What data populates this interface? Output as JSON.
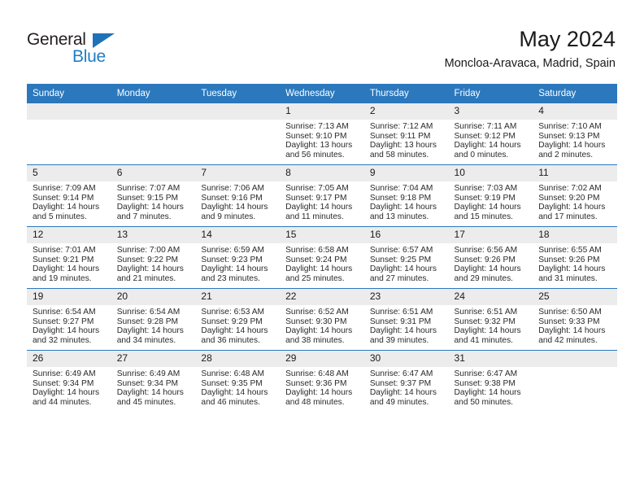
{
  "brand": {
    "logo_primary": "General",
    "logo_secondary": "Blue",
    "triangle_color": "#1f72b8",
    "accent_color": "#2b78bd"
  },
  "header": {
    "title": "May 2024",
    "subtitle": "Moncloa-Aravaca, Madrid, Spain"
  },
  "weekday_headers": [
    "Sunday",
    "Monday",
    "Tuesday",
    "Wednesday",
    "Thursday",
    "Friday",
    "Saturday"
  ],
  "labels": {
    "sunrise": "Sunrise:",
    "sunset": "Sunset:",
    "daylight": "Daylight:"
  },
  "weeks": [
    [
      {
        "day": "",
        "sunrise": "",
        "sunset": "",
        "daylight_1": "",
        "daylight_2": ""
      },
      {
        "day": "",
        "sunrise": "",
        "sunset": "",
        "daylight_1": "",
        "daylight_2": ""
      },
      {
        "day": "",
        "sunrise": "",
        "sunset": "",
        "daylight_1": "",
        "daylight_2": ""
      },
      {
        "day": "1",
        "sunrise": "Sunrise: 7:13 AM",
        "sunset": "Sunset: 9:10 PM",
        "daylight_1": "Daylight: 13 hours",
        "daylight_2": "and 56 minutes."
      },
      {
        "day": "2",
        "sunrise": "Sunrise: 7:12 AM",
        "sunset": "Sunset: 9:11 PM",
        "daylight_1": "Daylight: 13 hours",
        "daylight_2": "and 58 minutes."
      },
      {
        "day": "3",
        "sunrise": "Sunrise: 7:11 AM",
        "sunset": "Sunset: 9:12 PM",
        "daylight_1": "Daylight: 14 hours",
        "daylight_2": "and 0 minutes."
      },
      {
        "day": "4",
        "sunrise": "Sunrise: 7:10 AM",
        "sunset": "Sunset: 9:13 PM",
        "daylight_1": "Daylight: 14 hours",
        "daylight_2": "and 2 minutes."
      }
    ],
    [
      {
        "day": "5",
        "sunrise": "Sunrise: 7:09 AM",
        "sunset": "Sunset: 9:14 PM",
        "daylight_1": "Daylight: 14 hours",
        "daylight_2": "and 5 minutes."
      },
      {
        "day": "6",
        "sunrise": "Sunrise: 7:07 AM",
        "sunset": "Sunset: 9:15 PM",
        "daylight_1": "Daylight: 14 hours",
        "daylight_2": "and 7 minutes."
      },
      {
        "day": "7",
        "sunrise": "Sunrise: 7:06 AM",
        "sunset": "Sunset: 9:16 PM",
        "daylight_1": "Daylight: 14 hours",
        "daylight_2": "and 9 minutes."
      },
      {
        "day": "8",
        "sunrise": "Sunrise: 7:05 AM",
        "sunset": "Sunset: 9:17 PM",
        "daylight_1": "Daylight: 14 hours",
        "daylight_2": "and 11 minutes."
      },
      {
        "day": "9",
        "sunrise": "Sunrise: 7:04 AM",
        "sunset": "Sunset: 9:18 PM",
        "daylight_1": "Daylight: 14 hours",
        "daylight_2": "and 13 minutes."
      },
      {
        "day": "10",
        "sunrise": "Sunrise: 7:03 AM",
        "sunset": "Sunset: 9:19 PM",
        "daylight_1": "Daylight: 14 hours",
        "daylight_2": "and 15 minutes."
      },
      {
        "day": "11",
        "sunrise": "Sunrise: 7:02 AM",
        "sunset": "Sunset: 9:20 PM",
        "daylight_1": "Daylight: 14 hours",
        "daylight_2": "and 17 minutes."
      }
    ],
    [
      {
        "day": "12",
        "sunrise": "Sunrise: 7:01 AM",
        "sunset": "Sunset: 9:21 PM",
        "daylight_1": "Daylight: 14 hours",
        "daylight_2": "and 19 minutes."
      },
      {
        "day": "13",
        "sunrise": "Sunrise: 7:00 AM",
        "sunset": "Sunset: 9:22 PM",
        "daylight_1": "Daylight: 14 hours",
        "daylight_2": "and 21 minutes."
      },
      {
        "day": "14",
        "sunrise": "Sunrise: 6:59 AM",
        "sunset": "Sunset: 9:23 PM",
        "daylight_1": "Daylight: 14 hours",
        "daylight_2": "and 23 minutes."
      },
      {
        "day": "15",
        "sunrise": "Sunrise: 6:58 AM",
        "sunset": "Sunset: 9:24 PM",
        "daylight_1": "Daylight: 14 hours",
        "daylight_2": "and 25 minutes."
      },
      {
        "day": "16",
        "sunrise": "Sunrise: 6:57 AM",
        "sunset": "Sunset: 9:25 PM",
        "daylight_1": "Daylight: 14 hours",
        "daylight_2": "and 27 minutes."
      },
      {
        "day": "17",
        "sunrise": "Sunrise: 6:56 AM",
        "sunset": "Sunset: 9:26 PM",
        "daylight_1": "Daylight: 14 hours",
        "daylight_2": "and 29 minutes."
      },
      {
        "day": "18",
        "sunrise": "Sunrise: 6:55 AM",
        "sunset": "Sunset: 9:26 PM",
        "daylight_1": "Daylight: 14 hours",
        "daylight_2": "and 31 minutes."
      }
    ],
    [
      {
        "day": "19",
        "sunrise": "Sunrise: 6:54 AM",
        "sunset": "Sunset: 9:27 PM",
        "daylight_1": "Daylight: 14 hours",
        "daylight_2": "and 32 minutes."
      },
      {
        "day": "20",
        "sunrise": "Sunrise: 6:54 AM",
        "sunset": "Sunset: 9:28 PM",
        "daylight_1": "Daylight: 14 hours",
        "daylight_2": "and 34 minutes."
      },
      {
        "day": "21",
        "sunrise": "Sunrise: 6:53 AM",
        "sunset": "Sunset: 9:29 PM",
        "daylight_1": "Daylight: 14 hours",
        "daylight_2": "and 36 minutes."
      },
      {
        "day": "22",
        "sunrise": "Sunrise: 6:52 AM",
        "sunset": "Sunset: 9:30 PM",
        "daylight_1": "Daylight: 14 hours",
        "daylight_2": "and 38 minutes."
      },
      {
        "day": "23",
        "sunrise": "Sunrise: 6:51 AM",
        "sunset": "Sunset: 9:31 PM",
        "daylight_1": "Daylight: 14 hours",
        "daylight_2": "and 39 minutes."
      },
      {
        "day": "24",
        "sunrise": "Sunrise: 6:51 AM",
        "sunset": "Sunset: 9:32 PM",
        "daylight_1": "Daylight: 14 hours",
        "daylight_2": "and 41 minutes."
      },
      {
        "day": "25",
        "sunrise": "Sunrise: 6:50 AM",
        "sunset": "Sunset: 9:33 PM",
        "daylight_1": "Daylight: 14 hours",
        "daylight_2": "and 42 minutes."
      }
    ],
    [
      {
        "day": "26",
        "sunrise": "Sunrise: 6:49 AM",
        "sunset": "Sunset: 9:34 PM",
        "daylight_1": "Daylight: 14 hours",
        "daylight_2": "and 44 minutes."
      },
      {
        "day": "27",
        "sunrise": "Sunrise: 6:49 AM",
        "sunset": "Sunset: 9:34 PM",
        "daylight_1": "Daylight: 14 hours",
        "daylight_2": "and 45 minutes."
      },
      {
        "day": "28",
        "sunrise": "Sunrise: 6:48 AM",
        "sunset": "Sunset: 9:35 PM",
        "daylight_1": "Daylight: 14 hours",
        "daylight_2": "and 46 minutes."
      },
      {
        "day": "29",
        "sunrise": "Sunrise: 6:48 AM",
        "sunset": "Sunset: 9:36 PM",
        "daylight_1": "Daylight: 14 hours",
        "daylight_2": "and 48 minutes."
      },
      {
        "day": "30",
        "sunrise": "Sunrise: 6:47 AM",
        "sunset": "Sunset: 9:37 PM",
        "daylight_1": "Daylight: 14 hours",
        "daylight_2": "and 49 minutes."
      },
      {
        "day": "31",
        "sunrise": "Sunrise: 6:47 AM",
        "sunset": "Sunset: 9:38 PM",
        "daylight_1": "Daylight: 14 hours",
        "daylight_2": "and 50 minutes."
      },
      {
        "day": "",
        "sunrise": "",
        "sunset": "",
        "daylight_1": "",
        "daylight_2": ""
      }
    ]
  ]
}
